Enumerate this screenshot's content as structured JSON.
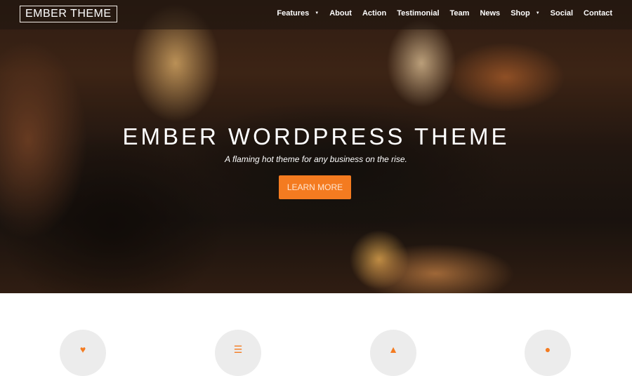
{
  "header": {
    "logo": "EMBER THEME",
    "nav": [
      {
        "label": "Features",
        "dropdown": true
      },
      {
        "label": "About",
        "dropdown": false
      },
      {
        "label": "Action",
        "dropdown": false
      },
      {
        "label": "Testimonial",
        "dropdown": false
      },
      {
        "label": "Team",
        "dropdown": false
      },
      {
        "label": "News",
        "dropdown": false
      },
      {
        "label": "Shop",
        "dropdown": true
      },
      {
        "label": "Social",
        "dropdown": false
      },
      {
        "label": "Contact",
        "dropdown": false
      }
    ],
    "caret_glyph": "▼"
  },
  "hero": {
    "title": "EMBER WORDPRESS THEME",
    "subtitle": "A flaming hot theme for any business on the rise.",
    "cta_label": "LEARN MORE"
  },
  "features": {
    "icons": [
      {
        "name": "heart-icon",
        "glyph": "♥"
      },
      {
        "name": "list-icon",
        "glyph": "☰"
      },
      {
        "name": "star-icon",
        "glyph": "▲"
      },
      {
        "name": "user-icon",
        "glyph": "●"
      }
    ]
  },
  "colors": {
    "accent": "#f47b20",
    "circle_bg": "#ececec"
  }
}
